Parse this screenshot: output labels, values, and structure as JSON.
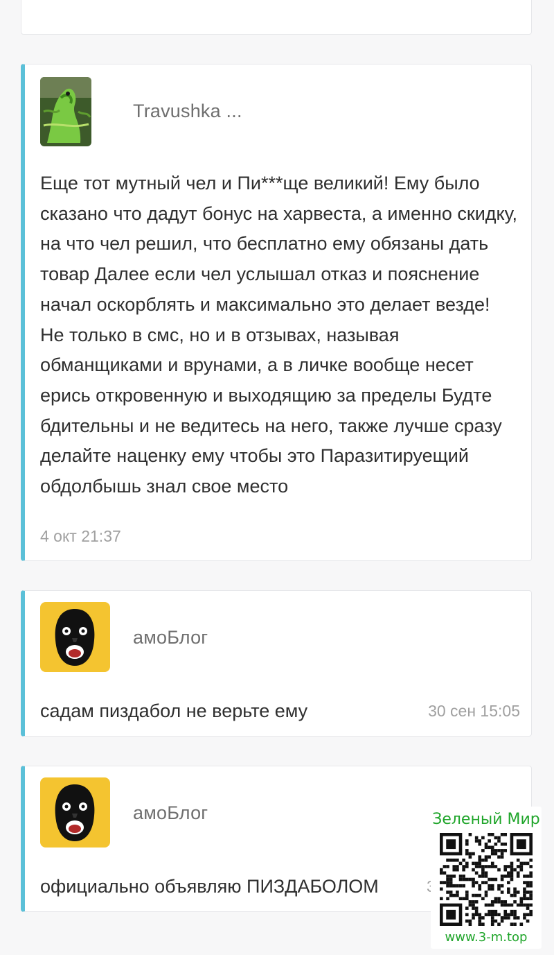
{
  "comments": [
    {
      "author": "Travushka ...",
      "text": "Еще тот мутный чел и Пи***ще великий! Ему было сказано что дадут бонус на харвеста, а именно скидку, на что чел решил, что бесплатно ему обязаны дать товар Далее если чел услышал отказ и пояснение начал оскорблять и максимально это делает везде! Не только в смс, но и в отзывах, называя обманщиками и врунами, а в личке вообще несет ерись откровенную и выходящию за пределы Будте бдительны и не ведитесь на него, также лучше сразу делайте наценку ему чтобы это Паразитируещий обдолбышь знал свое место",
      "date": "4 окт 21:37",
      "avatar_icon": "lizard-avatar"
    },
    {
      "author": "амоБлог",
      "text": "садам пиздабол не верьте ему",
      "date": "30 сен 15:05",
      "avatar_icon": "gorilla-avatar"
    },
    {
      "author": "амоБлог",
      "text": "официально объявляю ПИЗДАБОЛОМ",
      "date": "3",
      "avatar_icon": "gorilla-avatar"
    }
  ],
  "watermark": {
    "title": "Зеленый Мир",
    "url": "www.3-m.top"
  },
  "colors": {
    "accent_bar": "#5bc0d8",
    "watermark_green": "#1fa52a",
    "avatar_yellow": "#f4c430"
  }
}
